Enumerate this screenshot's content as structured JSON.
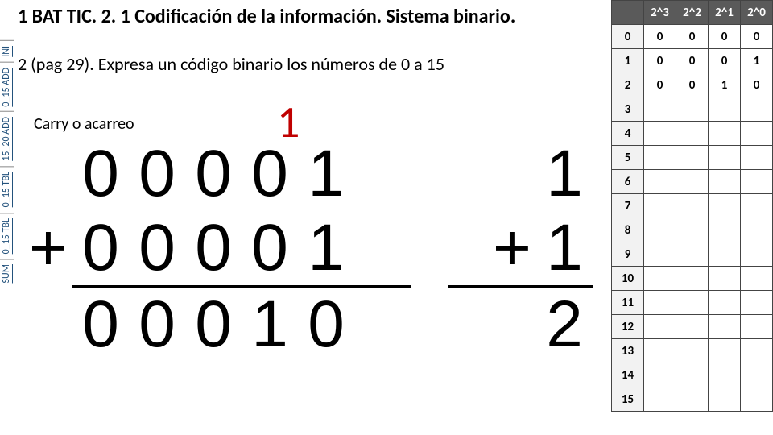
{
  "title": "1 BAT TIC. 2. 1 Codificación de la información. Sistema binario.",
  "subtitle": "2 (pag 29). Expresa un código binario los números de 0 a 15",
  "sidenav": {
    "items": [
      {
        "label": "INI"
      },
      {
        "label": "0_15 ADD"
      },
      {
        "label": "15_20 ADD"
      },
      {
        "label": "0_15 TBL"
      },
      {
        "label": "0_15 TBL"
      },
      {
        "label": "SUM"
      }
    ]
  },
  "carry": {
    "label": "Carry o acarreo",
    "digit": "1"
  },
  "binary_addition": {
    "addend1": [
      "0",
      "0",
      "0",
      "0",
      "1"
    ],
    "plus": "+",
    "addend2": [
      "0",
      "0",
      "0",
      "0",
      "1"
    ],
    "result": [
      "0",
      "0",
      "0",
      "1",
      "0"
    ]
  },
  "decimal_addition": {
    "addend1": "1",
    "plus": "+",
    "addend2": "1",
    "result": "2"
  },
  "table": {
    "headers": [
      "2^3",
      "2^2",
      "2^1",
      "2^0"
    ],
    "rows": [
      {
        "n": "0",
        "cells": [
          "0",
          "0",
          "0",
          "0"
        ]
      },
      {
        "n": "1",
        "cells": [
          "0",
          "0",
          "0",
          "1"
        ]
      },
      {
        "n": "2",
        "cells": [
          "0",
          "0",
          "1",
          "0"
        ]
      },
      {
        "n": "3",
        "cells": [
          "",
          "",
          "",
          ""
        ]
      },
      {
        "n": "4",
        "cells": [
          "",
          "",
          "",
          ""
        ]
      },
      {
        "n": "5",
        "cells": [
          "",
          "",
          "",
          ""
        ]
      },
      {
        "n": "6",
        "cells": [
          "",
          "",
          "",
          ""
        ]
      },
      {
        "n": "7",
        "cells": [
          "",
          "",
          "",
          ""
        ]
      },
      {
        "n": "8",
        "cells": [
          "",
          "",
          "",
          ""
        ]
      },
      {
        "n": "9",
        "cells": [
          "",
          "",
          "",
          ""
        ]
      },
      {
        "n": "10",
        "cells": [
          "",
          "",
          "",
          ""
        ]
      },
      {
        "n": "11",
        "cells": [
          "",
          "",
          "",
          ""
        ]
      },
      {
        "n": "12",
        "cells": [
          "",
          "",
          "",
          ""
        ]
      },
      {
        "n": "13",
        "cells": [
          "",
          "",
          "",
          ""
        ]
      },
      {
        "n": "14",
        "cells": [
          "",
          "",
          "",
          ""
        ]
      },
      {
        "n": "15",
        "cells": [
          "",
          "",
          "",
          ""
        ]
      }
    ]
  }
}
